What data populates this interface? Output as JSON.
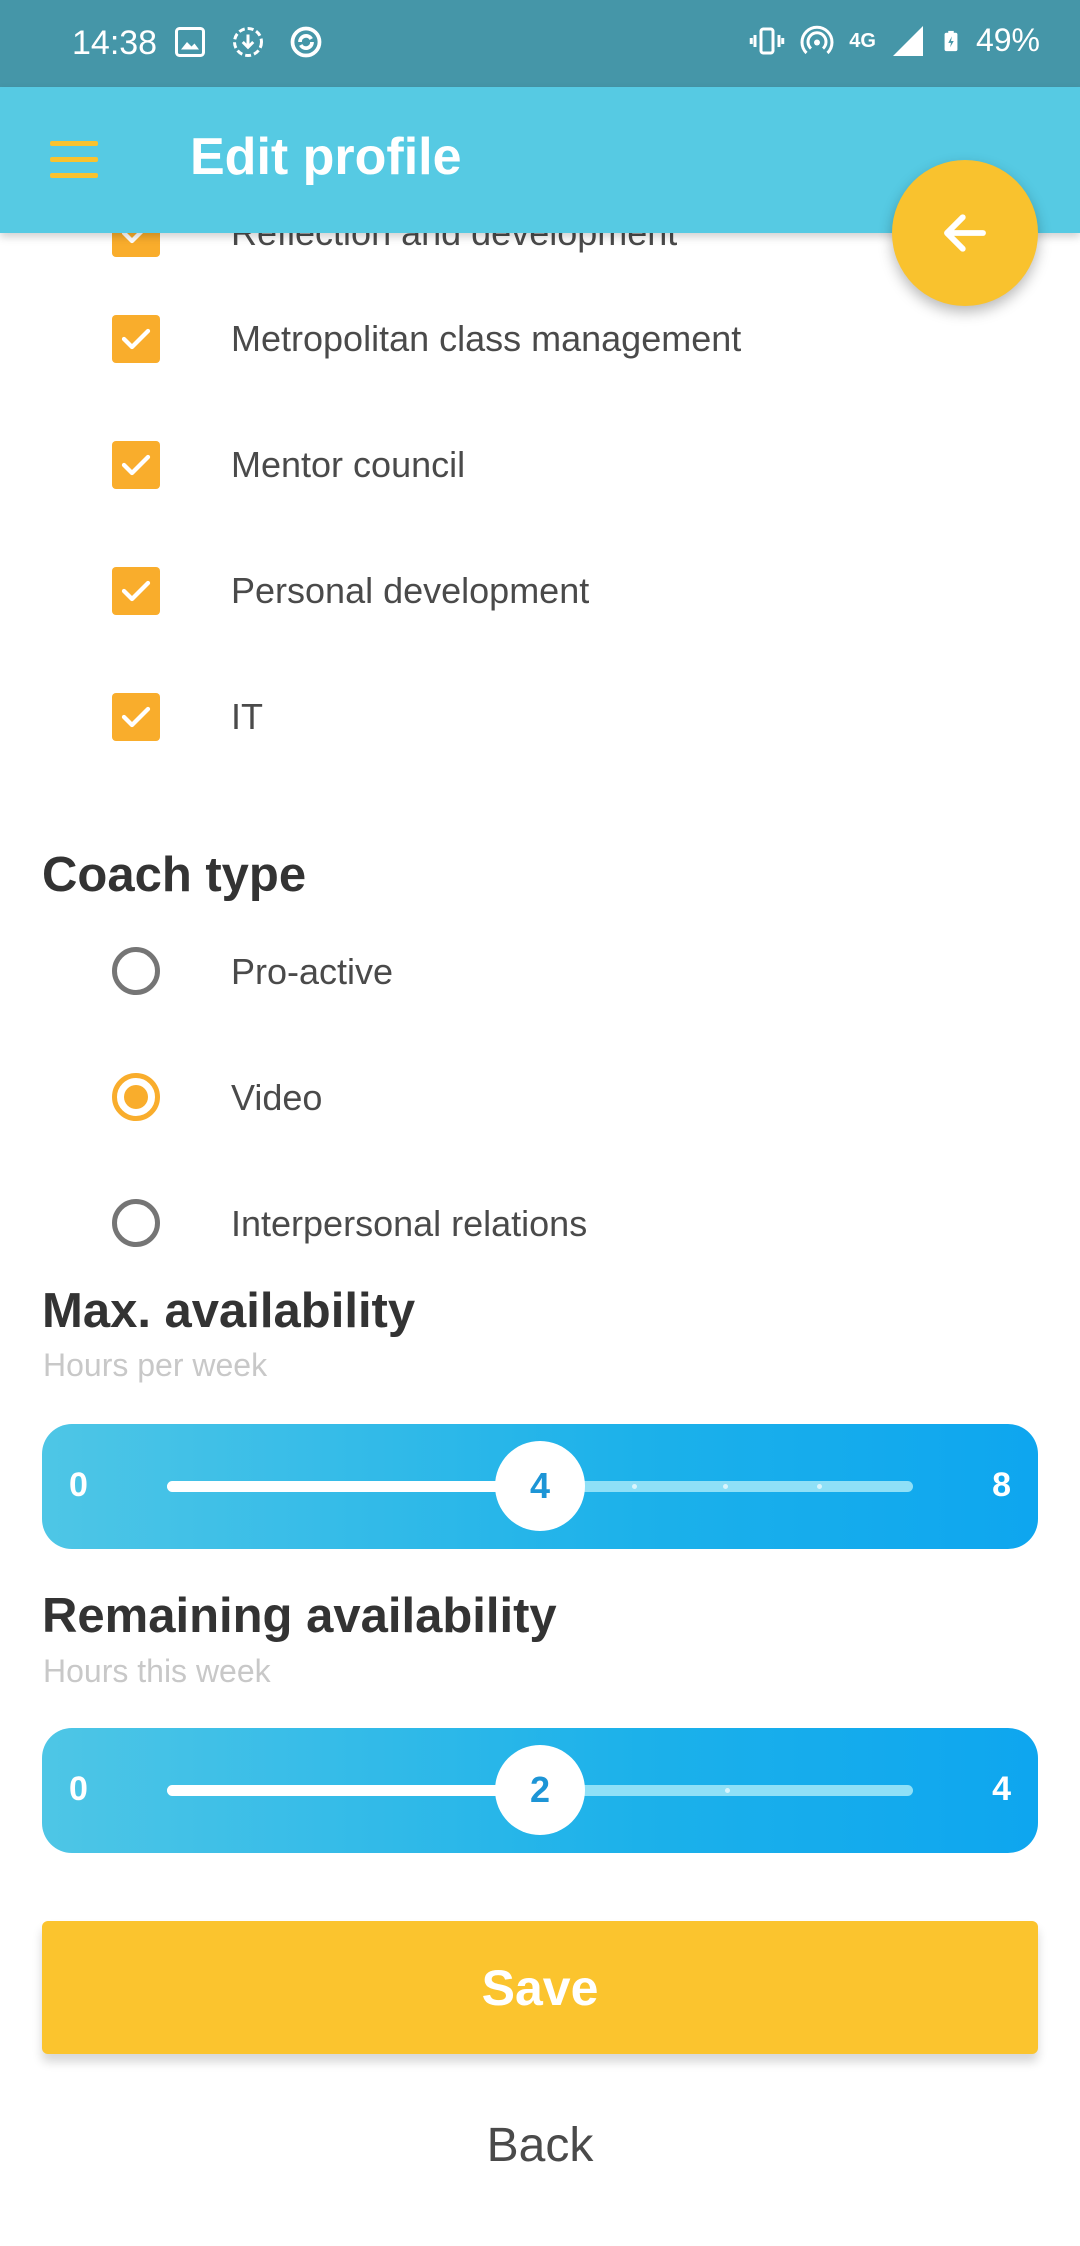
{
  "status_bar": {
    "time": "14:38",
    "network": "4G",
    "battery": "49%",
    "icons": [
      "image-icon",
      "download-icon",
      "sync-icon",
      "vibrate-icon",
      "hotspot-icon",
      "signal-icon",
      "battery-icon"
    ]
  },
  "app_bar": {
    "title": "Edit profile",
    "menu_icon": "menu-icon",
    "fab_icon": "arrow-left-icon",
    "color": "#56cae3",
    "accent": "#f9c22e"
  },
  "topics": [
    {
      "label": "Reflection and development",
      "checked": true
    },
    {
      "label": "Metropolitan class management",
      "checked": true
    },
    {
      "label": "Mentor council",
      "checked": true
    },
    {
      "label": "Personal development",
      "checked": true
    },
    {
      "label": "IT",
      "checked": true
    }
  ],
  "coach_type": {
    "title": "Coach type",
    "options": [
      {
        "label": "Pro-active",
        "selected": false
      },
      {
        "label": "Video",
        "selected": true
      },
      {
        "label": "Interpersonal relations",
        "selected": false
      }
    ]
  },
  "max_availability": {
    "title": "Max. availability",
    "subtitle": "Hours per week",
    "min": "0",
    "max": "8",
    "value": "4"
  },
  "remaining_availability": {
    "title": "Remaining availability",
    "subtitle": "Hours this week",
    "min": "0",
    "max": "4",
    "value": "2"
  },
  "actions": {
    "save_label": "Save",
    "back_label": "Back"
  }
}
